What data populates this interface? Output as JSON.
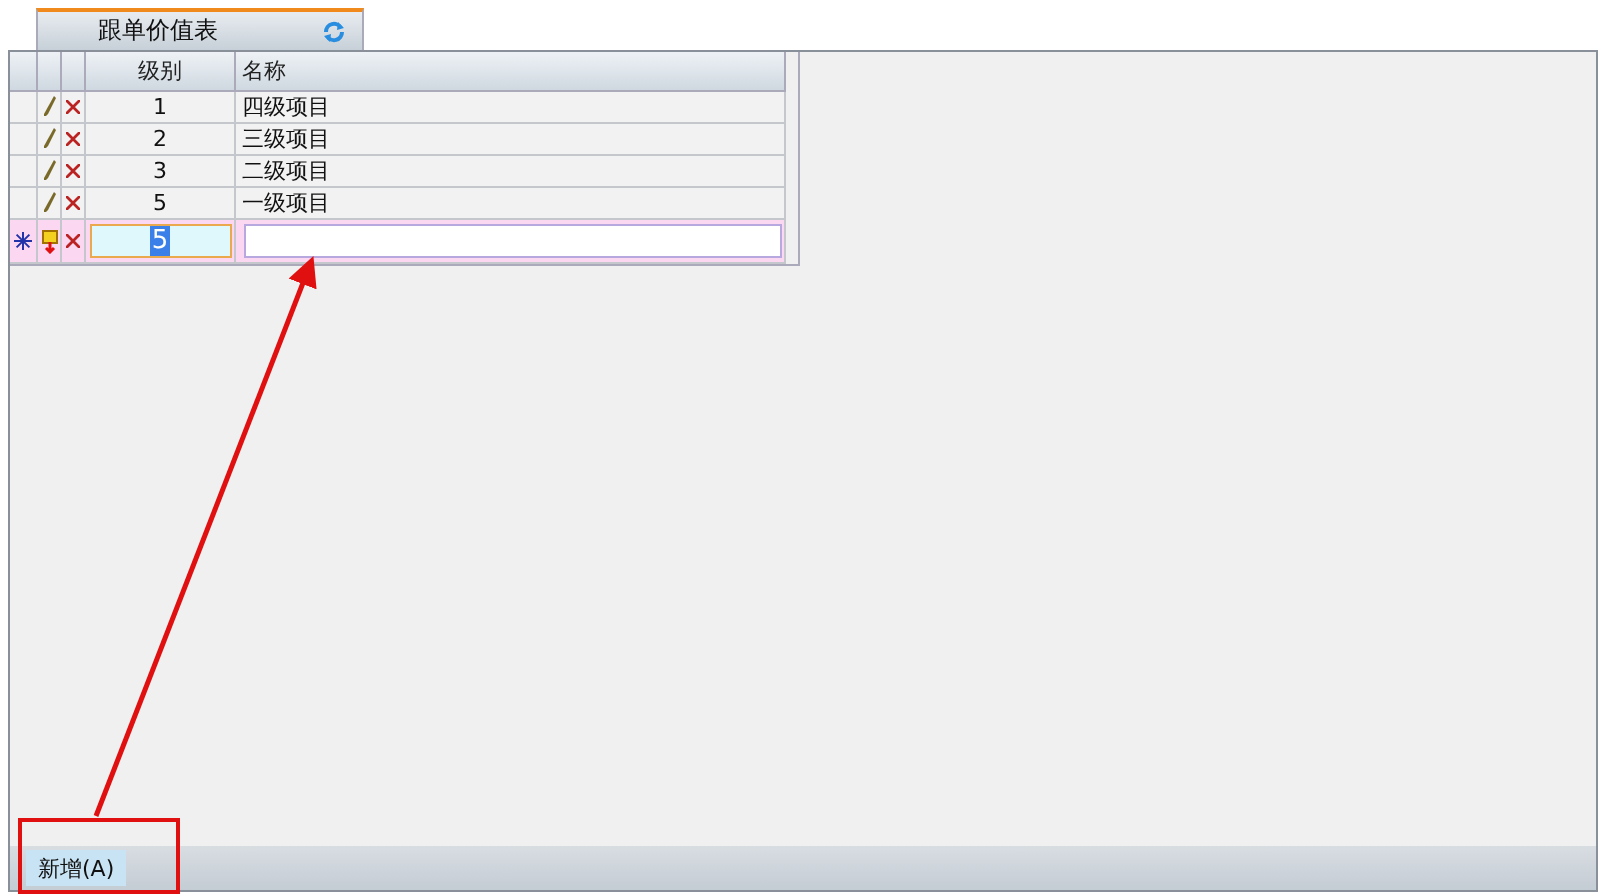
{
  "tabs": [
    {
      "label": "跟单价值表",
      "selected": true
    }
  ],
  "table": {
    "columns": [
      "级别",
      "名称"
    ],
    "rows": [
      {
        "kind": "saved",
        "level": "1",
        "name": "四级项目"
      },
      {
        "kind": "saved",
        "level": "2",
        "name": "三级项目"
      },
      {
        "kind": "saved",
        "level": "3",
        "name": "二级项目"
      },
      {
        "kind": "saved",
        "level": "5",
        "name": "一级项目"
      },
      {
        "kind": "new",
        "level": "5"
      }
    ]
  },
  "buttons": [
    "新增(A)"
  ]
}
